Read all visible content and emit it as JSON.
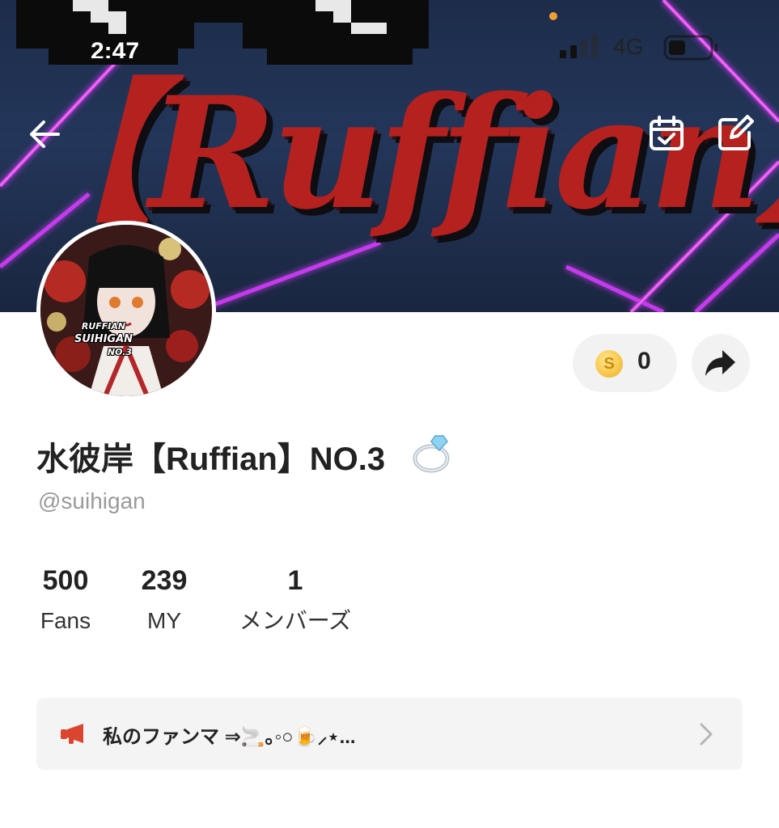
{
  "status_bar": {
    "time": "2:47",
    "network": "4G"
  },
  "banner": {
    "brand_text": "【Ruffian】"
  },
  "header_icons": [
    "back-arrow-icon",
    "calendar-check-icon",
    "edit-icon"
  ],
  "avatar": {
    "caption_line1": "RUFFIAN",
    "caption_line2": "SUIHIGAN",
    "caption_line3": "NO.3"
  },
  "coins": {
    "icon_letter": "S",
    "count": "0"
  },
  "profile": {
    "display_name": "水彼岸【Ruffian】NO.3",
    "username": "@suihigan"
  },
  "stats": [
    {
      "value": "500",
      "label": "Fans"
    },
    {
      "value": "239",
      "label": "MY"
    },
    {
      "value": "1",
      "label": "メンバーズ"
    }
  ],
  "fanmail": {
    "text": "私のファンマ ⇒🚬｡◦○🍺⸝⋆..."
  },
  "colors": {
    "brand_red": "#b4211f",
    "banner_bg": "#1d2c4a",
    "neon_pink": "#d83cff",
    "pill_bg": "#f2f2f2",
    "megaphone_red": "#d9452f"
  }
}
